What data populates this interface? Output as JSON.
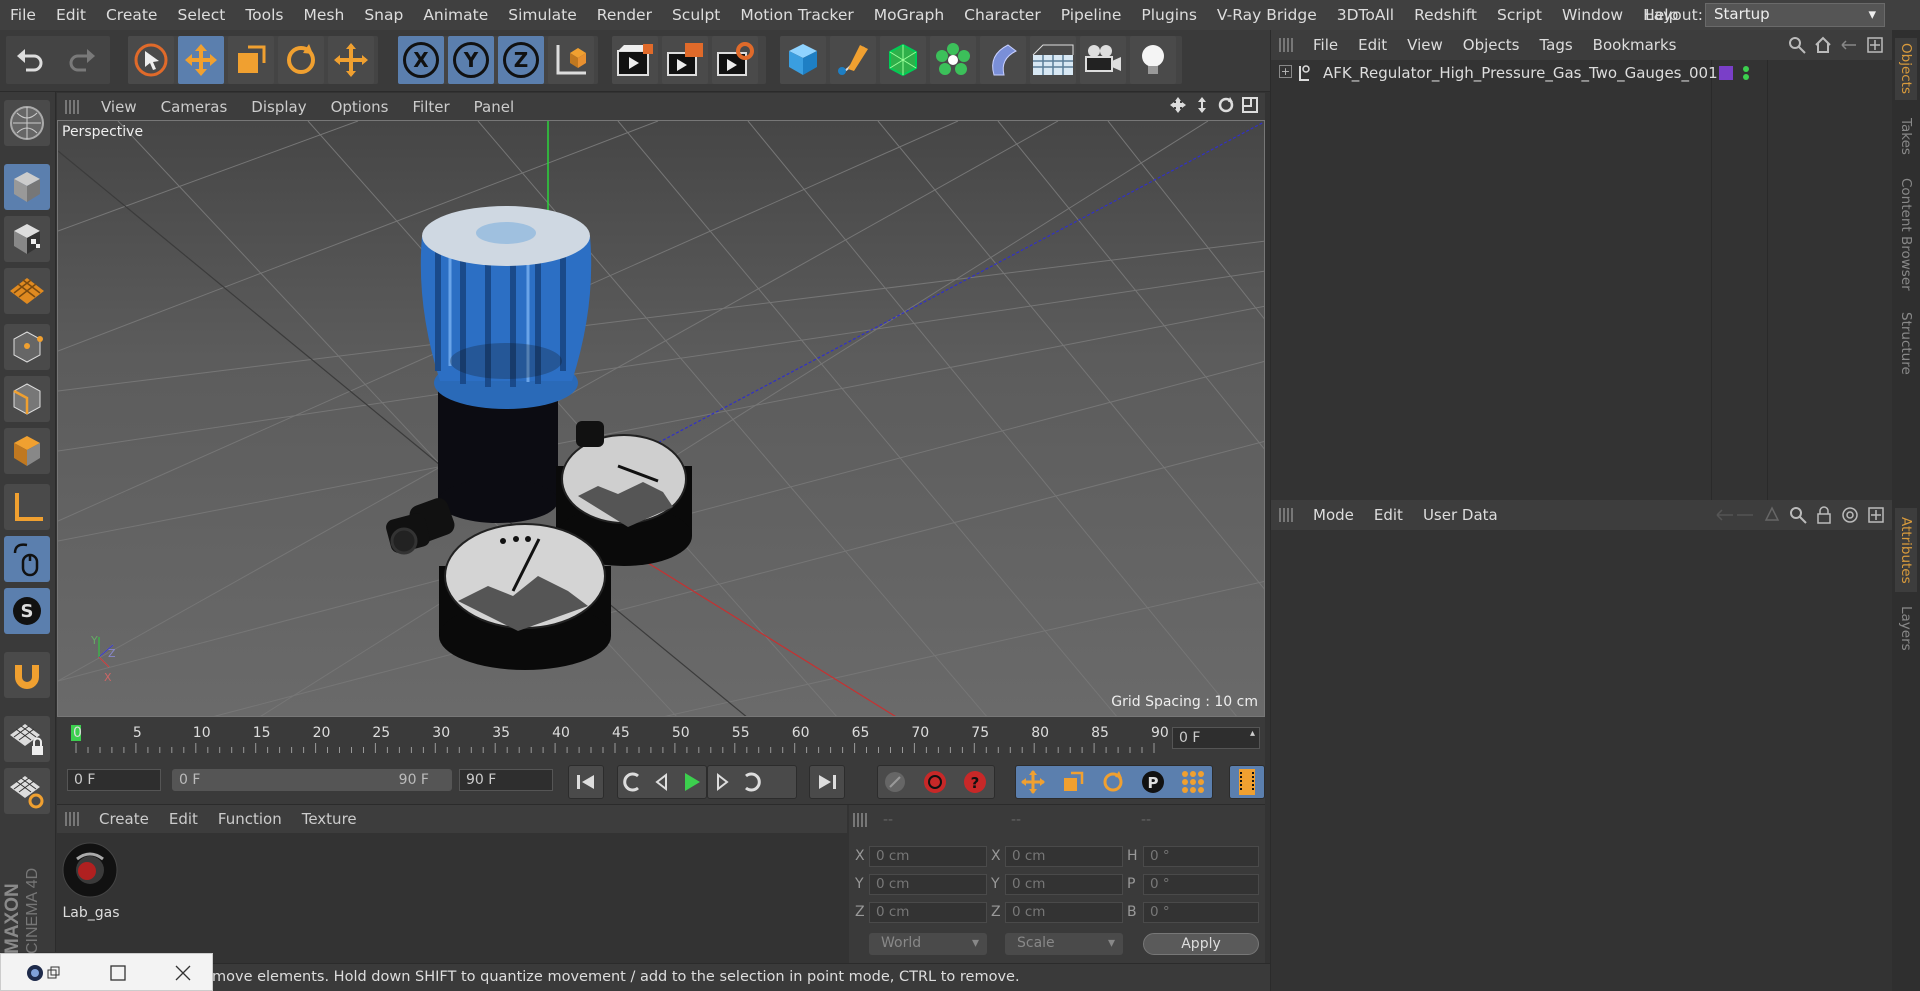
{
  "menubar": {
    "items": [
      "File",
      "Edit",
      "Create",
      "Select",
      "Tools",
      "Mesh",
      "Snap",
      "Animate",
      "Simulate",
      "Render",
      "Sculpt",
      "Motion Tracker",
      "MoGraph",
      "Character",
      "Pipeline",
      "Plugins",
      "V-Ray Bridge",
      "3DToAll",
      "Redshift",
      "Script",
      "Window",
      "Help"
    ],
    "layout_label": "Layout:",
    "layout_value": "Startup"
  },
  "toolbar": {
    "axis_x": "X",
    "axis_y": "Y",
    "axis_z": "Z"
  },
  "viewport": {
    "menu": [
      "View",
      "Cameras",
      "Display",
      "Options",
      "Filter",
      "Panel"
    ],
    "camera_label": "Perspective",
    "grid_spacing": "Grid Spacing : 10 cm",
    "axis_labels": {
      "y": "Y",
      "z": "Z",
      "x": "X"
    }
  },
  "timeline": {
    "ticks": [
      "0",
      "5",
      "10",
      "15",
      "20",
      "25",
      "30",
      "35",
      "40",
      "45",
      "50",
      "55",
      "60",
      "65",
      "70",
      "75",
      "80",
      "85",
      "90"
    ],
    "current_frame": "0 F"
  },
  "transport": {
    "start_field": "0 F",
    "range_start": "0 F",
    "range_end": "90 F",
    "end_field": "90 F"
  },
  "material_manager": {
    "menu": [
      "Create",
      "Edit",
      "Function",
      "Texture"
    ],
    "materials": [
      {
        "name": "Lab_gas"
      }
    ]
  },
  "coordinates": {
    "headers": [
      "--",
      "--",
      "--"
    ],
    "rows": [
      {
        "a_label": "X",
        "a_val": "0 cm",
        "b_label": "X",
        "b_val": "0 cm",
        "c_label": "H",
        "c_val": "0 °"
      },
      {
        "a_label": "Y",
        "a_val": "0 cm",
        "b_label": "Y",
        "b_val": "0 cm",
        "c_label": "P",
        "c_val": "0 °"
      },
      {
        "a_label": "Z",
        "a_val": "0 cm",
        "b_label": "Z",
        "b_val": "0 cm",
        "c_label": "B",
        "c_val": "0 °"
      }
    ],
    "mode_select": "World",
    "scale_select": "Scale",
    "apply": "Apply"
  },
  "status": {
    "text": "move elements. Hold down SHIFT to quantize movement / add to the selection in point mode, CTRL to remove."
  },
  "objects_panel": {
    "menu": [
      "File",
      "Edit",
      "View",
      "Objects",
      "Tags",
      "Bookmarks"
    ],
    "objects": [
      {
        "name": "AFK_Regulator_High_Pressure_Gas_Two_Gauges_001",
        "layer_color": "#7a3fc8"
      }
    ]
  },
  "attributes_panel": {
    "menu": [
      "Mode",
      "Edit",
      "User Data"
    ]
  },
  "side_tabs": {
    "top": [
      "Objects",
      "Takes",
      "Content Browser",
      "Structure"
    ],
    "bottom": [
      "Attributes",
      "Layers"
    ]
  },
  "brand": {
    "maxon": "MAXON",
    "product": "CINEMA 4D"
  },
  "colors": {
    "accent_blue": "#5b7fae",
    "accent_orange": "#d89a3c",
    "play_green": "#3ccf4e"
  }
}
